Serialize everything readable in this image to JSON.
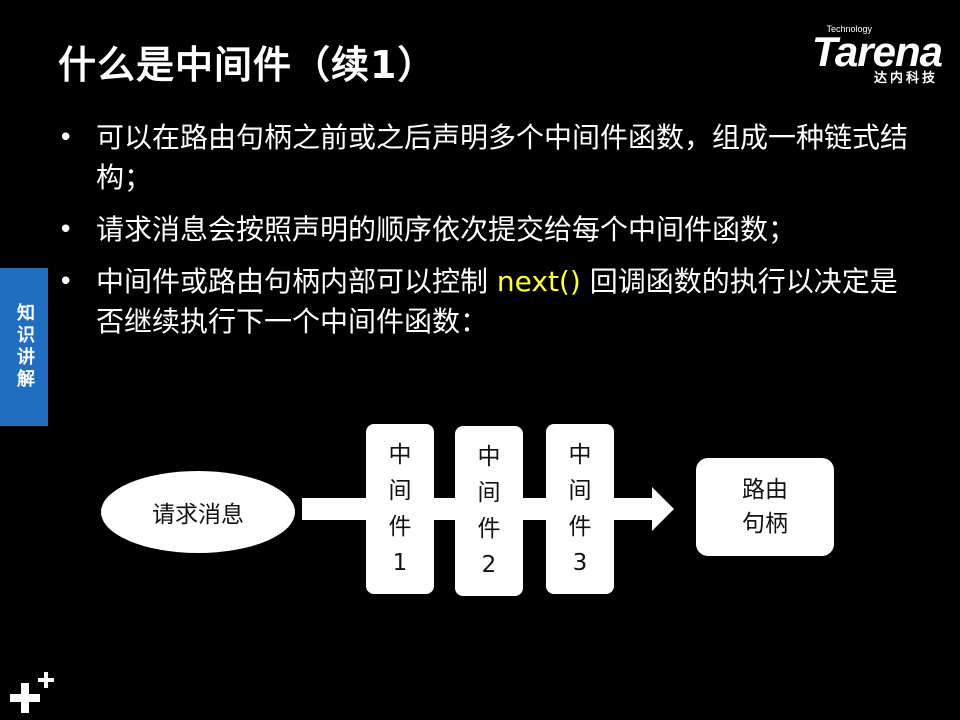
{
  "slide": {
    "title": "什么是中间件（续1）",
    "logo": {
      "tagline": "Technology",
      "brand": "Tarena",
      "chinese": "达内科技"
    },
    "side_tab": "知识讲解",
    "bullets": [
      {
        "text": "可以在路由句柄之前或之后声明多个中间件函数，组成一种链式结构；"
      },
      {
        "text": "请求消息会按照声明的顺序依次提交给每个中间件函数；"
      },
      {
        "before": "中间件或路由句柄内部可以控制 ",
        "highlight": "next()",
        "after": " 回调函数的执行以决定是否继续执行下一个中间件函数："
      }
    ],
    "bullet_glyph": "•",
    "highlight_color": "#ffff33",
    "side_tab_color": "#1f6ec2"
  },
  "diagram": {
    "request": "请求消息",
    "middlewares": [
      {
        "line1": "中",
        "line2": "间",
        "line3": "件",
        "line4": "1"
      },
      {
        "line1": "中",
        "line2": "间",
        "line3": "件",
        "line4": "2"
      },
      {
        "line1": "中",
        "line2": "间",
        "line3": "件",
        "line4": "3"
      }
    ],
    "route": {
      "line1": "路由",
      "line2": "句柄"
    }
  }
}
